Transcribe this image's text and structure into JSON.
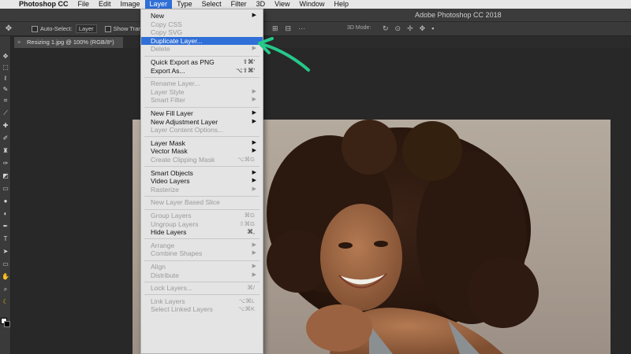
{
  "menubar": {
    "items": [
      "Photoshop CC",
      "File",
      "Edit",
      "Image",
      "Layer",
      "Type",
      "Select",
      "Filter",
      "3D",
      "View",
      "Window",
      "Help"
    ],
    "active_index": 4
  },
  "window": {
    "title": "Adobe Photoshop CC 2018"
  },
  "options_bar": {
    "auto_select_label": "Auto-Select:",
    "auto_select_value": "Layer",
    "show_transform_label": "Show Transform",
    "mode_3d_label": "3D Mode:"
  },
  "document_tab": {
    "title": "Resizing 1.jpg @ 100% (RGB/8*)"
  },
  "layer_menu": {
    "items": [
      {
        "label": "New",
        "submenu": true
      },
      {
        "label": "Copy CSS",
        "disabled": true
      },
      {
        "label": "Copy SVG",
        "disabled": true
      },
      {
        "label": "Duplicate Layer...",
        "highlighted": true
      },
      {
        "label": "Delete",
        "disabled": true,
        "submenu": true
      },
      {
        "separator": true
      },
      {
        "label": "Quick Export as PNG",
        "shortcut": "⇧⌘'"
      },
      {
        "label": "Export As...",
        "shortcut": "⌥⇧⌘'"
      },
      {
        "separator": true
      },
      {
        "label": "Rename Layer...",
        "disabled": true
      },
      {
        "label": "Layer Style",
        "disabled": true,
        "submenu": true
      },
      {
        "label": "Smart Filter",
        "disabled": true,
        "submenu": true
      },
      {
        "separator": true
      },
      {
        "label": "New Fill Layer",
        "submenu": true
      },
      {
        "label": "New Adjustment Layer",
        "submenu": true
      },
      {
        "label": "Layer Content Options...",
        "disabled": true
      },
      {
        "separator": true
      },
      {
        "label": "Layer Mask",
        "submenu": true
      },
      {
        "label": "Vector Mask",
        "submenu": true
      },
      {
        "label": "Create Clipping Mask",
        "disabled": true,
        "shortcut": "⌥⌘G"
      },
      {
        "separator": true
      },
      {
        "label": "Smart Objects",
        "submenu": true
      },
      {
        "label": "Video Layers",
        "submenu": true
      },
      {
        "label": "Rasterize",
        "disabled": true,
        "submenu": true
      },
      {
        "separator": true
      },
      {
        "label": "New Layer Based Slice",
        "disabled": true
      },
      {
        "separator": true
      },
      {
        "label": "Group Layers",
        "disabled": true,
        "shortcut": "⌘G"
      },
      {
        "label": "Ungroup Layers",
        "disabled": true,
        "shortcut": "⇧⌘G"
      },
      {
        "label": "Hide Layers",
        "shortcut": "⌘,"
      },
      {
        "separator": true
      },
      {
        "label": "Arrange",
        "disabled": true,
        "submenu": true
      },
      {
        "label": "Combine Shapes",
        "disabled": true,
        "submenu": true
      },
      {
        "separator": true
      },
      {
        "label": "Align",
        "disabled": true,
        "submenu": true
      },
      {
        "label": "Distribute",
        "disabled": true,
        "submenu": true
      },
      {
        "separator": true
      },
      {
        "label": "Lock Layers...",
        "disabled": true,
        "shortcut": "⌘/"
      },
      {
        "separator": true
      },
      {
        "label": "Link Layers",
        "disabled": true,
        "shortcut": "⌥⌘L"
      },
      {
        "label": "Select Linked Layers",
        "disabled": true,
        "shortcut": "⌥⌘K"
      }
    ]
  },
  "tools": {
    "icons": [
      "move-icon",
      "marquee-icon",
      "lasso-icon",
      "quick-select-icon",
      "crop-icon",
      "eyedropper-icon",
      "healing-icon",
      "brush-icon",
      "stamp-icon",
      "history-brush-icon",
      "eraser-icon",
      "gradient-icon",
      "blur-icon",
      "dodge-icon",
      "pen-icon",
      "type-icon",
      "path-select-icon",
      "shape-icon",
      "hand-icon",
      "zoom-icon",
      "banana-icon"
    ]
  },
  "colors": {
    "menu_highlight": "#2f6fd8",
    "annotation_arrow": "#25c98a"
  }
}
